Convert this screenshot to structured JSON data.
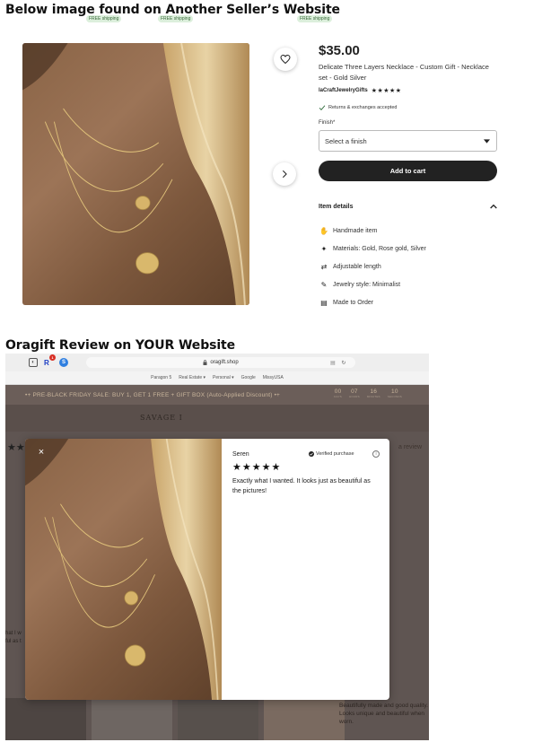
{
  "sections": {
    "top_title": "Below image found on Another Seller’s Website",
    "bottom_title": "Oragift Review on YOUR Website"
  },
  "free_shipping": [
    "FREE shipping",
    "FREE shipping",
    "FREE shipping"
  ],
  "listing": {
    "price": "$35.00",
    "title": "Delicate Three Layers Necklace - Custom Gift - Necklace set - Gold Silver",
    "shop_name": "laCraftJewelryGifts",
    "shop_rating_stars": "★★★★★",
    "returns": "Returns & exchanges accepted",
    "finish_label": "Finish",
    "finish_required": "*",
    "finish_placeholder": "Select a finish",
    "add_to_cart": "Add to cart",
    "item_details_heading": "Item details",
    "details": [
      {
        "icon": "hand-icon",
        "text": "Handmade item"
      },
      {
        "icon": "sparkle-icon",
        "text": "Materials: Gold, Rose gold, Silver"
      },
      {
        "icon": "arrows-icon",
        "text": "Adjustable length"
      },
      {
        "icon": "brush-icon",
        "text": "Jewelry style: Minimalist"
      },
      {
        "icon": "clipboard-icon",
        "text": "Made to Order"
      }
    ]
  },
  "browser": {
    "url": "oragift.shop",
    "bookmarks": [
      "Paragon 5",
      "Real Estate ▾",
      "Personal ▾",
      "Google",
      "MissyUSA"
    ],
    "promo": "•+ PRE-BLACK FRIDAY SALE: BUY 1, GET 1 FREE + GIFT BOX (Auto-Applied Discount) •+",
    "countdown": [
      {
        "num": "00",
        "lbl": "DAYS"
      },
      {
        "num": "07",
        "lbl": "HOURS"
      },
      {
        "num": "16",
        "lbl": "MINUTES"
      },
      {
        "num": "10",
        "lbl": "SECONDS"
      }
    ],
    "site_logo": "SAVAGE I",
    "page_stars": "★★",
    "write_review": "a review",
    "bg_left_text": [
      "hat I w",
      "ful as t"
    ],
    "bg_right_text": "Beautifully made and good quality. Looks unique and beautiful when worn."
  },
  "review": {
    "close_label": "×",
    "name": "Seren",
    "verified": "Verified purchase",
    "info": "i",
    "stars": "★★★★★",
    "rating": 5,
    "text": "Exactly what I wanted. It looks just as beautiful as the pictures!"
  },
  "colors": {
    "accent_dark": "#222222",
    "promo_bg": "#6b5e59",
    "promo_text": "#c9b59c"
  }
}
